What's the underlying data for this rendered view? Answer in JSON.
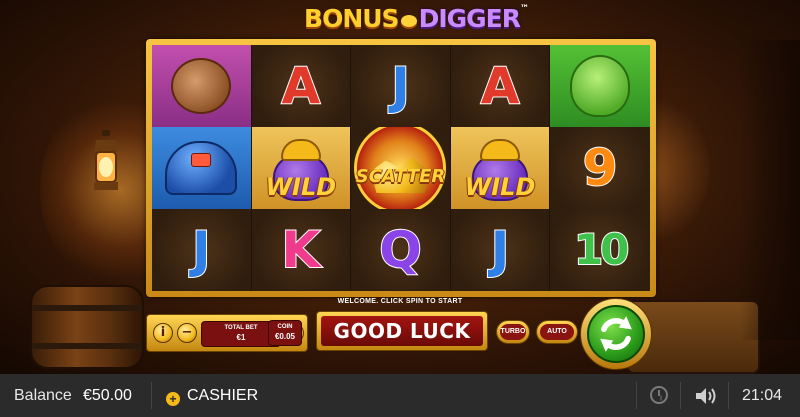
{
  "game": {
    "title_part1": "BONUS",
    "title_part2": "DIGGER",
    "trademark": "™"
  },
  "reels": {
    "rows": [
      [
        {
          "type": "character",
          "name": "armadillo-with-gold"
        },
        {
          "type": "letter",
          "text": "A",
          "color": "#e23a2a"
        },
        {
          "type": "letter",
          "text": "J",
          "color": "#2f7fe6"
        },
        {
          "type": "letter",
          "text": "A",
          "color": "#e23a2a"
        },
        {
          "type": "character",
          "name": "frog-with-hammer"
        }
      ],
      [
        {
          "type": "character",
          "name": "miner-helmet"
        },
        {
          "type": "wild",
          "text": "WILD"
        },
        {
          "type": "scatter",
          "text": "SCATTER"
        },
        {
          "type": "wild",
          "text": "WILD"
        },
        {
          "type": "letter",
          "text": "9",
          "color": "#ff8a12"
        }
      ],
      [
        {
          "type": "letter",
          "text": "J",
          "color": "#2f7fe6"
        },
        {
          "type": "letter",
          "text": "K",
          "color": "#f03a8c"
        },
        {
          "type": "letter",
          "text": "Q",
          "color": "#8a44e8"
        },
        {
          "type": "letter",
          "text": "J",
          "color": "#2f7fe6"
        },
        {
          "type": "letter",
          "text": "10",
          "color": "#3fc14c"
        }
      ]
    ]
  },
  "message": "WELCOME. CLICK SPIN TO START",
  "controls": {
    "info_label": "i",
    "minus_label": "−",
    "plus_label": "+",
    "total_bet_caption": "TOTAL BET",
    "total_bet_value": "€1",
    "coin_caption": "COIN",
    "coin_value": "€0.05",
    "status_button": "GOOD LUCK",
    "turbo_label": "TURBO",
    "auto_label": "AUTO",
    "spin_icon": "refresh-arrows-icon"
  },
  "bottom_bar": {
    "balance_label": "Balance",
    "balance_value": "€50.00",
    "cashier_icon_glyph": "+",
    "cashier_label": "CASHIER",
    "history_icon": "history-clock-icon",
    "sound_icon": "speaker-icon",
    "time": "21:04"
  },
  "colors": {
    "frame_gold": "#f7c542",
    "button_red": "#a3140f",
    "spin_green": "#2a9a1a",
    "bar_bg": "#2b2b2b"
  }
}
